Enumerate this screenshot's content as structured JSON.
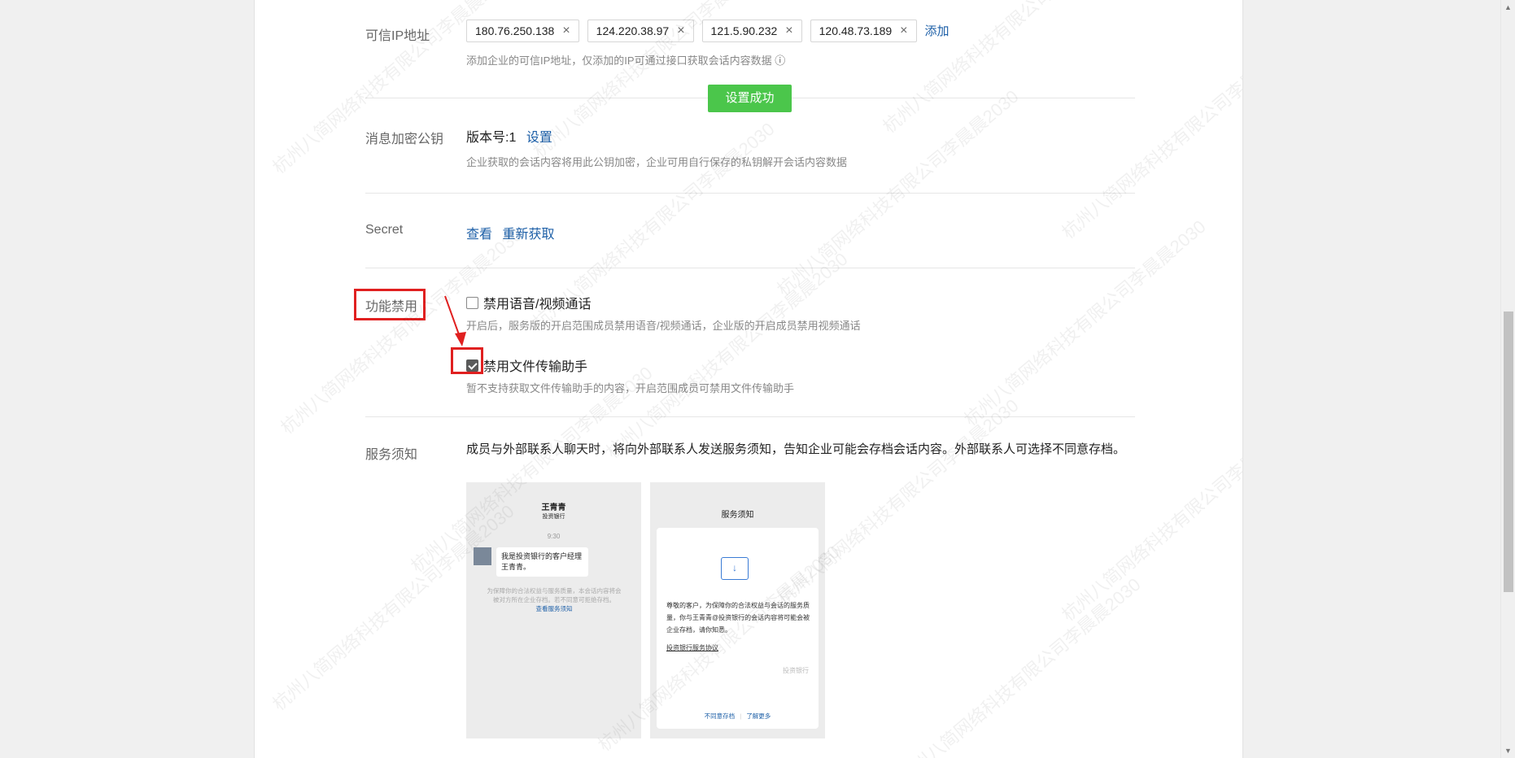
{
  "trusted_ip": {
    "label": "可信IP地址",
    "ips": [
      "180.76.250.138",
      "124.220.38.97",
      "121.5.90.232",
      "120.48.73.189"
    ],
    "add_label": "添加",
    "desc": "添加企业的可信IP地址，仅添加的IP可通过接口获取会话内容数据",
    "info_icon": "ⓘ"
  },
  "toast": "设置成功",
  "encryption": {
    "label": "消息加密公钥",
    "version": "版本号:1",
    "set_label": "设置",
    "desc": "企业获取的会话内容将用此公钥加密，企业可用自行保存的私钥解开会话内容数据"
  },
  "secret": {
    "label": "Secret",
    "view_label": "查看",
    "refresh_label": "重新获取"
  },
  "disable": {
    "label": "功能禁用",
    "voice": {
      "label": "禁用语音/视频通话",
      "checked": false,
      "desc": "开启后，服务版的开启范围成员禁用语音/视频通话，企业版的开启成员禁用视频通话"
    },
    "file": {
      "label": "禁用文件传输助手",
      "checked": true,
      "desc": "暂不支持获取文件传输助手的内容，开启范围成员可禁用文件传输助手"
    }
  },
  "service": {
    "label": "服务须知",
    "desc": "成员与外部联系人聊天时，将向外部联系人发送服务须知，告知企业可能会存档会话内容。外部联系人可选择不同意存档。",
    "preview_left": {
      "name": "王青青",
      "company": "投资银行",
      "time": "9:30",
      "message": "我是投资银行的客户经理王青青。",
      "notice": "为保障你的合法权益与服务质量，本会话内容将会被对方所在企业存档。若不同意可拒绝存档。",
      "notice_link": "查看服务须知"
    },
    "preview_right": {
      "title": "服务须知",
      "body": "尊敬的客户，为保障你的合法权益与会话的服务质量，你与王青青@投资银行的会话内容将可能会被企业存档，请你知悉。",
      "agreement": "投资银行服务协议",
      "company": "投资银行",
      "disagree": "不同意存档",
      "learn_more": "了解更多"
    }
  },
  "watermark": "杭州八简网络科技有限公司李晨晨2030"
}
